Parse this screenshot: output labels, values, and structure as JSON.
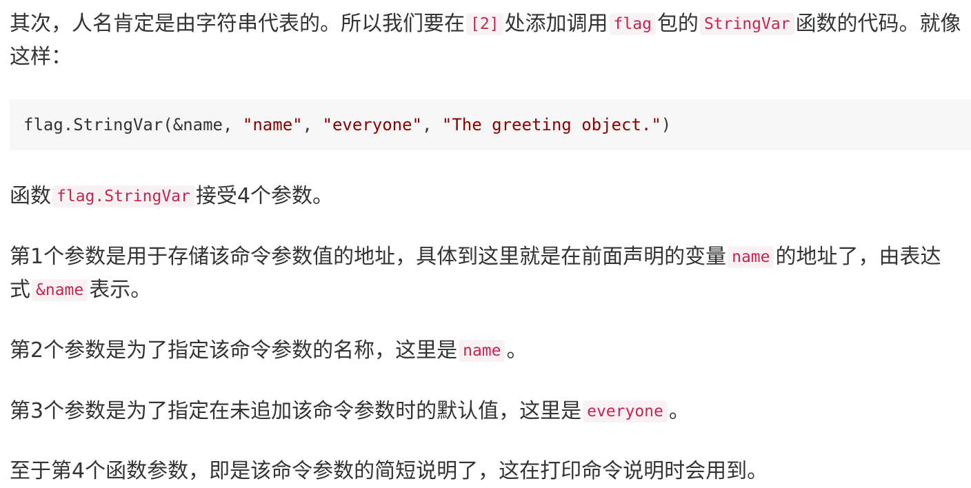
{
  "p1": {
    "t1": "其次，人名肯定是由字符串代表的。所以我们要在",
    "c1": "[2]",
    "t2": "处添加调用",
    "c2": "flag",
    "t3": "包的",
    "c3": "StringVar",
    "t4": "函数的代码。就像这样："
  },
  "code": {
    "part1": "flag.StringVar(&name, ",
    "str1": "\"name\"",
    "sep1": ", ",
    "str2": "\"everyone\"",
    "sep2": ", ",
    "str3": "\"The greeting object.\"",
    "end": ")"
  },
  "p2": {
    "t1": "函数",
    "c1": "flag.StringVar",
    "t2": "接受4个参数。"
  },
  "p3": {
    "t1": "第1个参数是用于存储该命令参数值的地址，具体到这里就是在前面声明的变量",
    "c1": "name",
    "t2": "的地址了，由表达式",
    "c2": "&name",
    "t3": "表示。"
  },
  "p4": {
    "t1": "第2个参数是为了指定该命令参数的名称，这里是",
    "c1": "name",
    "t2": "。"
  },
  "p5": {
    "t1": "第3个参数是为了指定在未追加该命令参数时的默认值，这里是",
    "c1": "everyone",
    "t2": "。"
  },
  "p6": {
    "t1": "至于第4个函数参数，即是该命令参数的简短说明了，这在打印命令说明时会用到。"
  }
}
